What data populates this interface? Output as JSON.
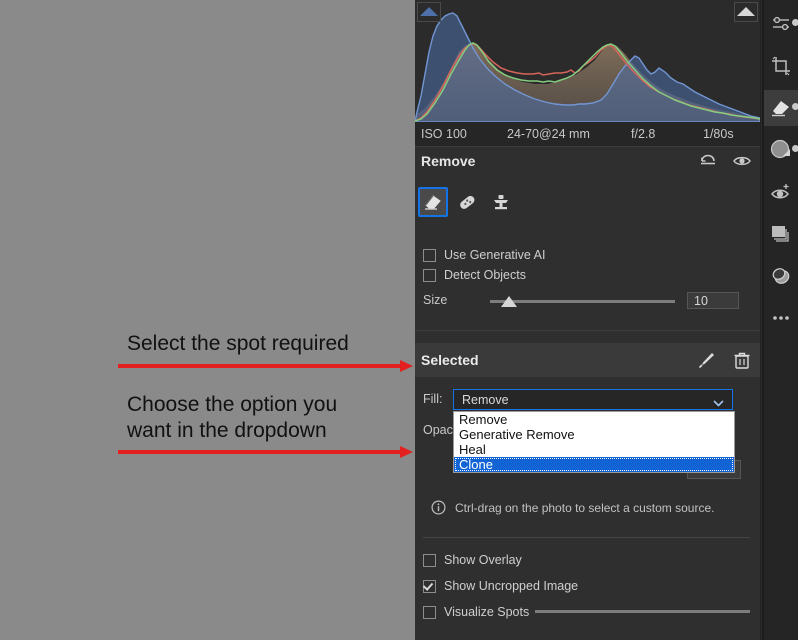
{
  "annotations": {
    "note1": "Select the spot required",
    "note2": "Choose the option you\nwant in the dropdown",
    "arrow_color": "#e32020"
  },
  "histogram": {
    "clip_shadow_icon": "shadow-clipping-triangle",
    "clip_highlight_icon": "highlight-clipping-triangle",
    "metadata": {
      "iso": "ISO 100",
      "lens": "24-70@24 mm",
      "aperture": "f/2.8",
      "shutter": "1/80s"
    },
    "colors": {
      "blue": "#6f8fc9",
      "red": "#d86a62",
      "green": "#7dc47a",
      "fill": "#8a7360"
    }
  },
  "remove_panel": {
    "title": "Remove",
    "reset_icon": "undo-icon",
    "visibility_icon": "eye-icon",
    "tools": [
      {
        "name": "eraser-tool",
        "label": "Remove",
        "selected": true
      },
      {
        "name": "heal-tool",
        "label": "Heal",
        "selected": false
      },
      {
        "name": "clone-tool",
        "label": "Clone",
        "selected": false
      }
    ],
    "checkboxes": [
      {
        "name": "use-generative-ai",
        "label": "Use Generative AI",
        "checked": false
      },
      {
        "name": "detect-objects",
        "label": "Detect Objects",
        "checked": false
      }
    ],
    "info_icon": "info-icon",
    "size": {
      "label": "Size",
      "value": "10"
    }
  },
  "selected_panel": {
    "title": "Selected",
    "refine_icon": "brush-icon",
    "delete_icon": "trash-icon",
    "fill": {
      "label": "Fill:",
      "value": "Remove",
      "chevron_icon": "chevron-down-icon",
      "options": [
        "Remove",
        "Generative Remove",
        "Heal",
        "Clone"
      ],
      "highlighted_option": "Clone",
      "highlight_color": "#1264d4"
    },
    "opacity": {
      "label": "Opacity"
    }
  },
  "hint": {
    "icon": "info-icon",
    "text": "Ctrl-drag on the photo to select a custom source."
  },
  "bottom_options": [
    {
      "name": "show-overlay",
      "label": "Show Overlay",
      "checked": false
    },
    {
      "name": "show-uncropped-image",
      "label": "Show Uncropped Image",
      "checked": true
    },
    {
      "name": "visualize-spots",
      "label": "Visualize Spots",
      "checked": false
    }
  ],
  "rail": [
    {
      "name": "edit-sliders-icon",
      "active": false,
      "dot": true
    },
    {
      "name": "crop-icon",
      "active": false,
      "dot": false
    },
    {
      "name": "remove-eraser-icon",
      "active": true,
      "dot": true
    },
    {
      "name": "masking-icon",
      "active": false,
      "dot": true
    },
    {
      "name": "red-eye-icon",
      "active": false,
      "dot": false
    },
    {
      "name": "versions-layers-icon",
      "active": false,
      "dot": false
    },
    {
      "name": "lens-blur-icon",
      "active": false,
      "dot": false
    },
    {
      "name": "more-options-icon",
      "active": false,
      "dot": false
    }
  ]
}
